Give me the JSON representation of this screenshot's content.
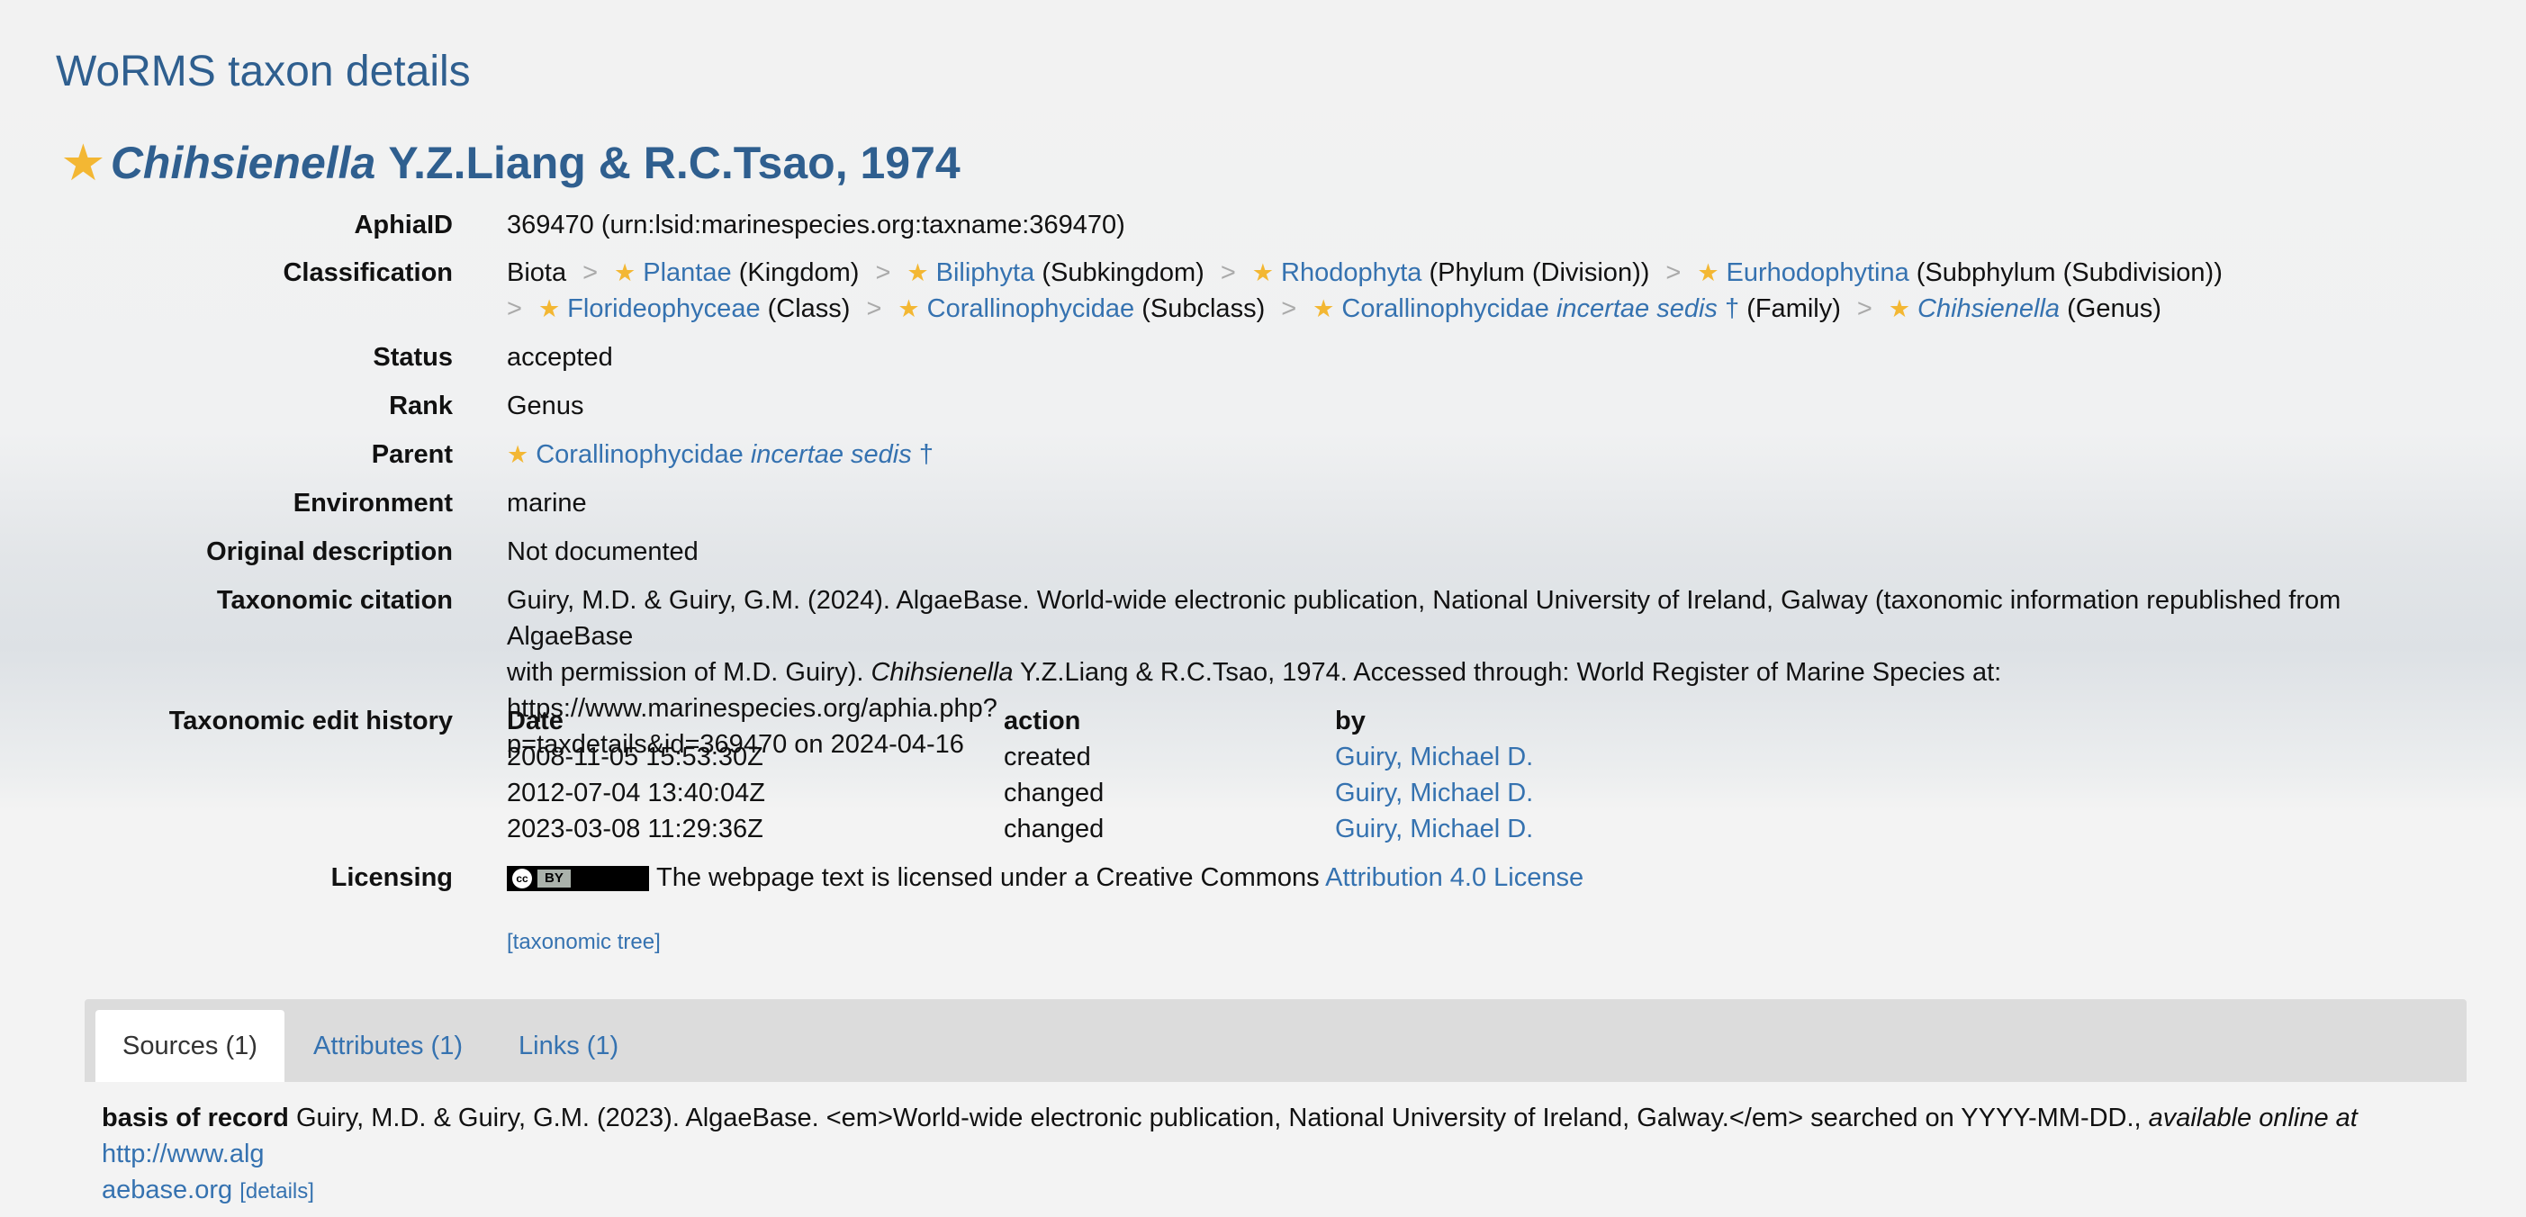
{
  "site_title": "WoRMS taxon details",
  "taxon": {
    "genus": "Chihsienella",
    "authority": "Y.Z.Liang & R.C.Tsao, 1974"
  },
  "labels": {
    "aphia": "AphiaID",
    "classification": "Classification",
    "status": "Status",
    "rank": "Rank",
    "parent": "Parent",
    "environment": "Environment",
    "original": "Original description",
    "citation": "Taxonomic citation",
    "history": "Taxonomic edit history",
    "licensing": "Licensing"
  },
  "aphia_id": "369470  (urn:lsid:marinespecies.org:taxname:369470)",
  "classification": {
    "root": "Biota",
    "items": [
      {
        "name": "Plantae",
        "rank": "(Kingdom)"
      },
      {
        "name": "Biliphyta",
        "rank": "(Subkingdom)"
      },
      {
        "name": "Rhodophyta",
        "rank": "(Phylum (Division))"
      },
      {
        "name": "Eurhodophytina",
        "rank": "(Subphylum (Subdivision))"
      },
      {
        "name": "Florideophyceae",
        "rank": "(Class)"
      },
      {
        "name": "Corallinophycidae",
        "rank": "(Subclass)"
      },
      {
        "name": "Corallinophycidae",
        "name_italic": "incertae sedis",
        "dagger": "†",
        "rank": "(Family)"
      },
      {
        "name_italic": "Chihsienella",
        "rank": "(Genus)"
      }
    ],
    "separator": ">"
  },
  "status": "accepted",
  "rank": "Genus",
  "parent": {
    "name": "Corallinophycidae",
    "italic": "incertae sedis",
    "dagger": "†"
  },
  "environment": "marine",
  "original_description": "Not documented",
  "citation": {
    "part1": "Guiry, M.D. & Guiry, G.M. (2024). AlgaeBase. World-wide electronic publication, National University of Ireland, Galway (taxonomic information republished from AlgaeBase",
    "part2": "with permission of M.D. Guiry). ",
    "genus": "Chihsienella",
    "part3": " Y.Z.Liang & R.C.Tsao, 1974. Accessed through: World Register of Marine Species at: https://www.marinespecies.org/aphia.php?",
    "part4": "p=taxdetails&id=369470 on 2024-04-16"
  },
  "history": {
    "headers": [
      "Date",
      "action",
      "by"
    ],
    "rows": [
      {
        "date": "2008-11-05 15:53:30Z",
        "action": "created",
        "by": "Guiry, Michael D."
      },
      {
        "date": "2012-07-04 13:40:04Z",
        "action": "changed",
        "by": "Guiry, Michael D."
      },
      {
        "date": "2023-03-08 11:29:36Z",
        "action": "changed",
        "by": "Guiry, Michael D."
      }
    ]
  },
  "licensing": {
    "badge_cc": "cc",
    "badge_by": "BY",
    "text": "The webpage text is licensed under a Creative Commons ",
    "link": "Attribution 4.0 License"
  },
  "tree_link": "[taxonomic tree]",
  "tabs": [
    "Sources (1)",
    "Attributes (1)",
    "Links (1)"
  ],
  "sources": {
    "bold": "basis of record",
    "text": " Guiry, M.D. & Guiry, G.M. (2023). AlgaeBase. <em>World-wide electronic publication, National University of Ireland, Galway.</em> searched on YYYY-MM-DD., ",
    "italic": "available online at",
    "link1": "http://www.alg",
    "link2": "aebase.org",
    "details": "[details]"
  },
  "colors": {
    "accent": "#2f5f8f",
    "link": "#3572b0",
    "star": "#f3b733"
  },
  "icons": {
    "star": "star-icon"
  }
}
